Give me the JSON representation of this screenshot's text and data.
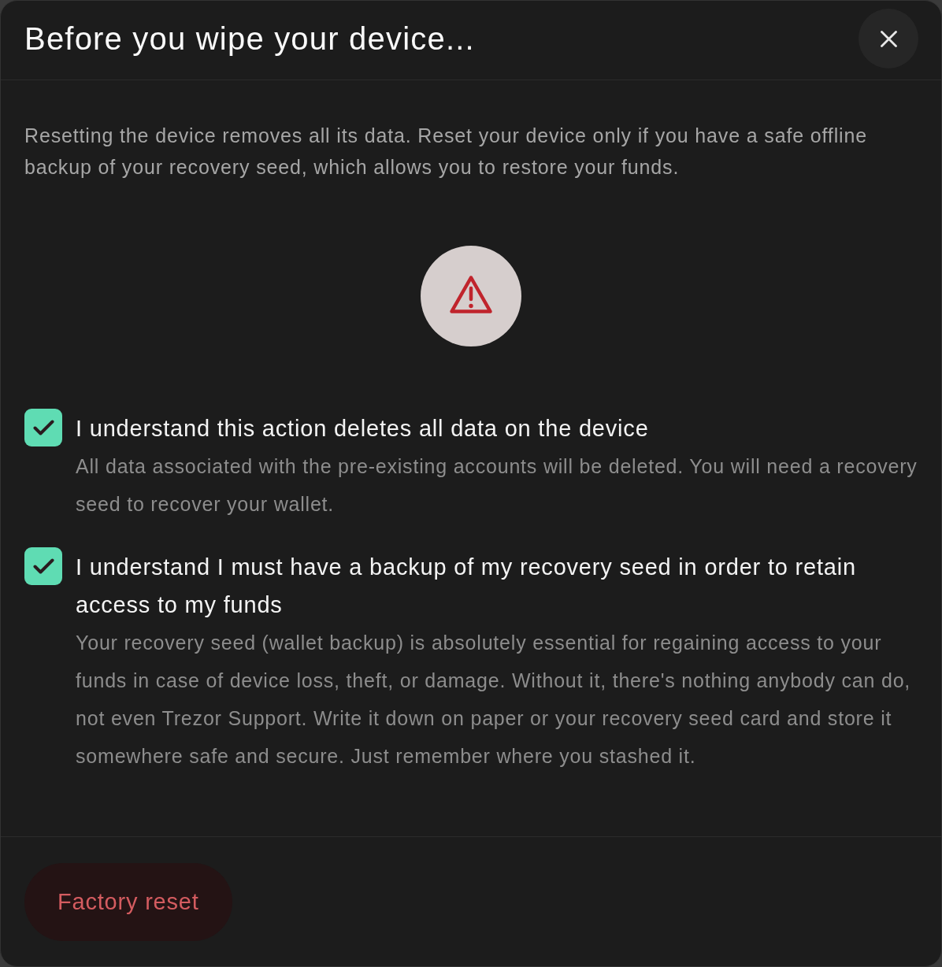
{
  "dialog": {
    "title": "Before you wipe your device...",
    "description": "Resetting the device removes all its data. Reset your device only if you have a safe offline backup of your recovery seed, which allows you to restore your funds.",
    "checkboxes": [
      {
        "label": "I understand this action deletes all data on the device",
        "description": "All data associated with the pre-existing accounts will be deleted. You will need a recovery seed to recover your wallet.",
        "checked": true
      },
      {
        "label": "I understand I must have a backup of my recovery seed in order to retain access to my funds",
        "description": "Your recovery seed (wallet backup) is absolutely essential for regaining access to your funds in case of device loss, theft, or damage. Without it, there's nothing anybody can do, not even Trezor Support. Write it down on paper or your recovery seed card and store it somewhere safe and secure. Just remember where you stashed it.",
        "checked": true
      }
    ],
    "footer_button": "Factory reset"
  }
}
